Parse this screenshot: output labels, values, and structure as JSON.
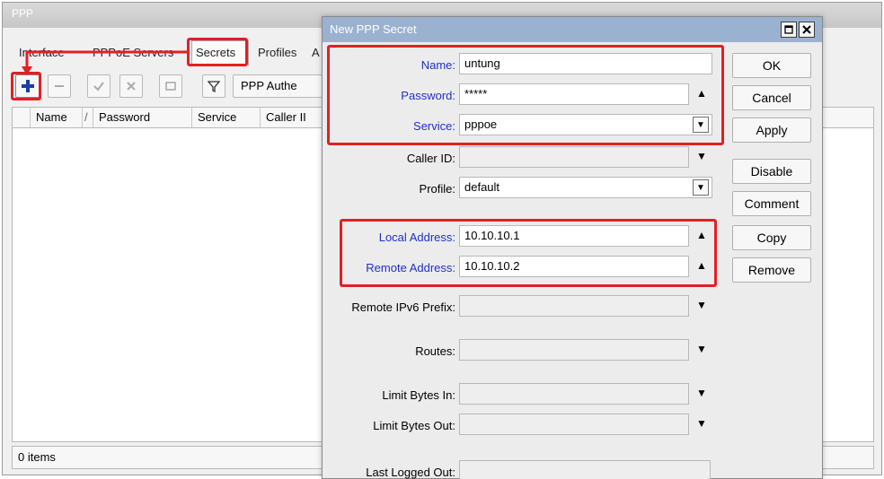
{
  "ppp": {
    "title": "PPP",
    "tabs": [
      "Interface",
      "PPPoE Servers",
      "Secrets",
      "Profiles",
      "A"
    ],
    "toolbar": {
      "auth_button_label": "PPP Authe"
    },
    "columns": [
      "Name",
      "Password",
      "Service",
      "Caller II"
    ],
    "sort_indicator": "/",
    "status": "0 items"
  },
  "dialog": {
    "title": "New PPP Secret",
    "fields": {
      "name": {
        "label": "Name:",
        "value": "untung"
      },
      "password": {
        "label": "Password:",
        "value": "*****"
      },
      "service": {
        "label": "Service:",
        "value": "pppoe"
      },
      "caller_id": {
        "label": "Caller ID:",
        "value": ""
      },
      "profile": {
        "label": "Profile:",
        "value": "default"
      },
      "local_address": {
        "label": "Local Address:",
        "value": "10.10.10.1"
      },
      "remote_address": {
        "label": "Remote Address:",
        "value": "10.10.10.2"
      },
      "remote_ipv6_prefix": {
        "label": "Remote IPv6 Prefix:",
        "value": ""
      },
      "routes": {
        "label": "Routes:",
        "value": ""
      },
      "limit_bytes_in": {
        "label": "Limit Bytes In:",
        "value": ""
      },
      "limit_bytes_out": {
        "label": "Limit Bytes Out:",
        "value": ""
      },
      "last_logged_out": {
        "label": "Last Logged Out:",
        "value": ""
      }
    },
    "buttons": {
      "ok": "OK",
      "cancel": "Cancel",
      "apply": "Apply",
      "disable": "Disable",
      "comment": "Comment",
      "copy": "Copy",
      "remove": "Remove"
    }
  },
  "icons": {
    "add": "plus-icon",
    "remove": "minus-icon",
    "enable": "check-icon",
    "disable": "cross-icon",
    "comment": "note-icon",
    "filter": "funnel-icon"
  },
  "colors": {
    "highlight": "#e31f26",
    "label_blue": "#1f2fc8",
    "dialog_title_bg": "#9ab2d0",
    "add_icon": "#1a3ea8"
  }
}
